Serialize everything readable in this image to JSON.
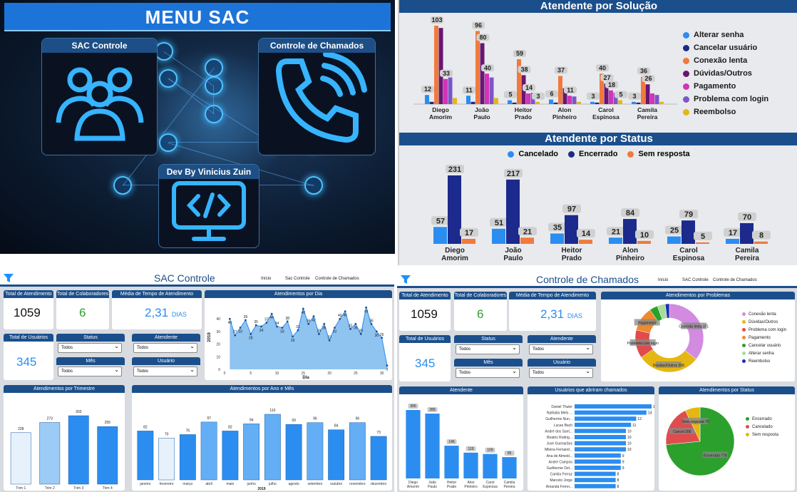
{
  "menu": {
    "title": "MENU SAC",
    "cards": [
      {
        "label": "SAC Controle",
        "icon": "users-group-icon"
      },
      {
        "label": "Controle de Chamados",
        "icon": "phone-icon"
      },
      {
        "label": "Dev By Vinicius Zuin",
        "icon": "code-monitor-icon"
      }
    ]
  },
  "solucao": {
    "title": "Atendente por Solução",
    "legend": [
      {
        "name": "Alterar senha",
        "color": "#2b8df0"
      },
      {
        "name": "Cancelar usuário",
        "color": "#1b2a8c"
      },
      {
        "name": "Conexão lenta",
        "color": "#f07a3c"
      },
      {
        "name": "Dúvidas/Outros",
        "color": "#6a1572"
      },
      {
        "name": "Pagamento",
        "color": "#d233b8"
      },
      {
        "name": "Problema com login",
        "color": "#7d55c7"
      },
      {
        "name": "Reembolso",
        "color": "#e5b713"
      }
    ],
    "chart_data": {
      "type": "bar",
      "categories": [
        "Diego Amorim",
        "João Paulo",
        "Heitor Prado",
        "Alon Pinheiro",
        "Carol Espinosa",
        "Camila Pereira"
      ],
      "series": [
        {
          "name": "Alterar senha",
          "values": [
            12,
            11,
            5,
            6,
            3,
            3
          ]
        },
        {
          "name": "Cancelar usuário",
          "values": [
            3,
            3,
            2,
            2,
            2,
            2
          ]
        },
        {
          "name": "Conexão lenta",
          "values": [
            103,
            96,
            59,
            37,
            40,
            36
          ]
        },
        {
          "name": "Dúvidas/Outros",
          "values": [
            100,
            80,
            38,
            21,
            27,
            26
          ]
        },
        {
          "name": "Pagamento",
          "values": [
            33,
            40,
            14,
            11,
            18,
            14
          ]
        },
        {
          "name": "Problema com login",
          "values": [
            35,
            35,
            15,
            10,
            15,
            12
          ]
        },
        {
          "name": "Reembolso",
          "values": [
            8,
            8,
            3,
            3,
            5,
            3
          ]
        }
      ],
      "labels": [
        [
          "12",
          "",
          "103",
          "",
          "33",
          "",
          ""
        ],
        [
          "11",
          "",
          "96",
          "80",
          "40",
          "",
          ""
        ],
        [
          "5",
          "",
          "59",
          "38",
          "14",
          "",
          "3"
        ],
        [
          "6",
          "",
          "37",
          "",
          "11",
          "",
          ""
        ],
        [
          "3",
          "",
          "40",
          "27",
          "18",
          "",
          "5"
        ],
        [
          "3",
          "",
          "36",
          "26",
          "",
          "",
          ""
        ]
      ]
    }
  },
  "status": {
    "title": "Atendente por Status",
    "legend": [
      {
        "name": "Cancelado",
        "color": "#2b8df0"
      },
      {
        "name": "Encerrado",
        "color": "#1b2a8c"
      },
      {
        "name": "Sem resposta",
        "color": "#f07a3c"
      }
    ],
    "chart_data": {
      "type": "bar",
      "categories": [
        "Diego Amorim",
        "João Paulo",
        "Heitor Prado",
        "Alon Pinheiro",
        "Carol Espinosa",
        "Camila Pereira"
      ],
      "series": [
        {
          "name": "Cancelado",
          "values": [
            57,
            51,
            35,
            21,
            25,
            17
          ]
        },
        {
          "name": "Encerrado",
          "values": [
            231,
            217,
            97,
            84,
            79,
            70
          ]
        },
        {
          "name": "Sem resposta",
          "values": [
            17,
            21,
            14,
            10,
            5,
            8
          ]
        }
      ]
    }
  },
  "sac": {
    "title_a": "SAC",
    "title_b": " Controle",
    "nav": [
      "Início",
      "Sac Controle",
      "Controle de Chamados"
    ],
    "kpis": {
      "total_atendimento_label": "Total de Atendimento",
      "total_atendimento": "1059",
      "total_colab_label": "Total de Colaboradores",
      "total_colab": "6",
      "media_label": "Média de Tempo de Atendimento",
      "media": "2,31",
      "media_unit": "DIAS",
      "total_usuarios_label": "Total de Usuários",
      "total_usuarios": "345"
    },
    "slicers": {
      "status_label": "Status",
      "status_value": "Todos",
      "mes_label": "Mês",
      "mes_value": "Todos",
      "atendente_label": "Atendente",
      "atendente_value": "Todos",
      "usuario_label": "Usuário",
      "usuario_value": "Todos"
    },
    "dia": {
      "title": "Atendimentos por Dia",
      "chart_data": {
        "type": "area",
        "x": [
          1,
          2,
          3,
          4,
          5,
          6,
          7,
          8,
          9,
          10,
          11,
          12,
          13,
          14,
          15,
          16,
          17,
          18,
          19,
          20,
          21,
          22,
          23,
          24,
          25,
          26,
          27,
          28,
          29,
          30,
          31
        ],
        "values": [
          40,
          27,
          33,
          39,
          28,
          35,
          34,
          37,
          44,
          34,
          33,
          38,
          26,
          31,
          48,
          36,
          42,
          28,
          36,
          23,
          33,
          40,
          46,
          32,
          36,
          28,
          49,
          36,
          30,
          25,
          3
        ],
        "xlabel": "Dia",
        "ylabel": "2019",
        "xticks": [
          "0",
          "5",
          "10",
          "15",
          "20",
          "25",
          "30"
        ],
        "yticks": [
          "0",
          "10",
          "20",
          "30",
          "40"
        ],
        "ylim": [
          0,
          52
        ]
      }
    },
    "trimestre": {
      "title": "Atendimentos por Trimestre",
      "chart_data": {
        "type": "bar",
        "categories": [
          "Trim 1",
          "Trim 2",
          "Trim 3",
          "Trim 4"
        ],
        "values": [
          228,
          273,
          303,
          255
        ]
      }
    },
    "anomes": {
      "title": "Atendimentos por Ano e Mês",
      "xlabel": "2019",
      "chart_data": {
        "type": "bar",
        "categories": [
          "janeiro",
          "fevereiro",
          "março",
          "abril",
          "maio",
          "junho",
          "julho",
          "agosto",
          "setembro",
          "outubro",
          "novembro",
          "dezembro"
        ],
        "values": [
          82,
          70,
          76,
          97,
          82,
          94,
          110,
          93,
          96,
          84,
          96,
          73
        ]
      }
    }
  },
  "chamados": {
    "title_a": "Controle",
    "title_b": " de Chamados",
    "nav": [
      "Início",
      "SAC Controle",
      "Controle de Chamados"
    ],
    "problemas": {
      "title": "Atendimentos por Problemas",
      "legend": [
        {
          "name": "Conexão lenta",
          "color": "#d28be0"
        },
        {
          "name": "Dúvidas/Outros",
          "color": "#e5b713"
        },
        {
          "name": "Problema com login",
          "color": "#e04c4c"
        },
        {
          "name": "Pagamento",
          "color": "#f08a2c"
        },
        {
          "name": "Cancelar usuário",
          "color": "#2ca02c"
        },
        {
          "name": "Alterar senha",
          "color": "#a7dd9b"
        },
        {
          "name": "Reembolso",
          "color": "#1f2db3"
        }
      ],
      "chart_data": {
        "type": "pie",
        "categories": [
          "Conexão lenta",
          "Dúvidas/Outros",
          "Problema com login",
          "Pagamento",
          "Cancelar usuário",
          "Alterar senha",
          "Reembolso"
        ],
        "values": [
          371,
          308,
          140,
          120,
          40,
          40,
          20
        ],
        "labels": [
          "Conexão lenta 371",
          "Dúvidas/Outros 308",
          "Problema com login",
          "Pagamento",
          "",
          "",
          ""
        ]
      }
    },
    "atendente": {
      "title": "Atendente",
      "chart_data": {
        "type": "bar",
        "categories": [
          "Diego Amorim",
          "João Paulo",
          "Heitor Prado",
          "Alon Pinheiro",
          "Carol Espinosa",
          "Camila Pereira"
        ],
        "values": [
          305,
          289,
          146,
          115,
          109,
          95
        ]
      }
    },
    "usuarios": {
      "title": "Usuários que abriram chamados",
      "chart_data": {
        "type": "bar",
        "categories": [
          "Daniel Thuler",
          "Nathalia Melo ...",
          "Guilherme Nun...",
          "Lucas Bach",
          "André dos Sant...",
          "Beatriz Rodrig...",
          "José Guimarães",
          "Milena Fernand...",
          "Ana de Almeid...",
          "Andre Campos",
          "Guilherme Del...",
          "Camila Ferraz",
          "Marcelo Jorge",
          "Amanda Ferrei..."
        ],
        "values": [
          15,
          14,
          12,
          11,
          10,
          10,
          10,
          10,
          9,
          9,
          9,
          8,
          8,
          8
        ]
      }
    },
    "status": {
      "title": "Atendimentos por Status",
      "legend": [
        {
          "name": "Encerrado",
          "color": "#2ca02c"
        },
        {
          "name": "Cancelado",
          "color": "#e04c4c"
        },
        {
          "name": "Sem resposta",
          "color": "#e5b713"
        }
      ],
      "chart_data": {
        "type": "pie",
        "categories": [
          "Encerrado",
          "Cancelado",
          "Sem resposta"
        ],
        "values": [
          778,
          206,
          75
        ],
        "labels": [
          "Encerrado 778",
          "Cancel 206",
          "Sem resposta 75"
        ]
      }
    }
  }
}
